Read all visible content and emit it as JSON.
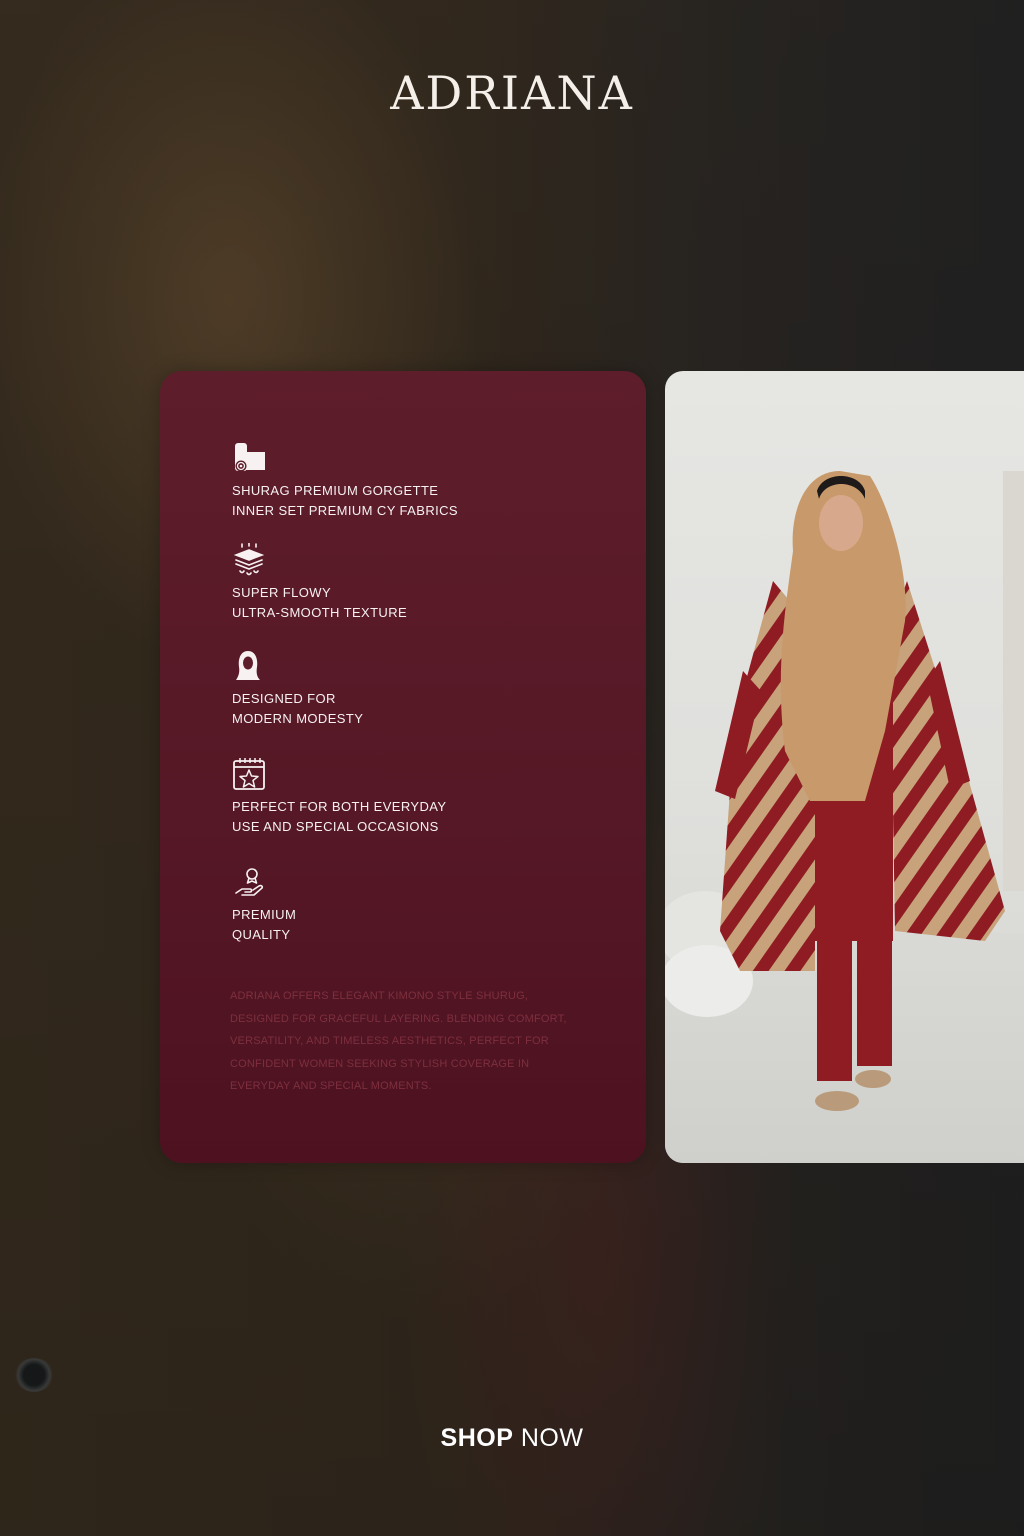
{
  "brand": {
    "name": "ADRIANA"
  },
  "features": [
    {
      "icon": "fabric-roll-icon",
      "line1": "SHURAG PREMIUM GORGETTE",
      "line2": "INNER SET PREMIUM CY FABRICS"
    },
    {
      "icon": "flowy-texture-icon",
      "line1": "SUPER FLOWY",
      "line2": "ULTRA-SMOOTH TEXTURE"
    },
    {
      "icon": "hijab-woman-icon",
      "line1": "DESIGNED FOR",
      "line2": "MODERN MODESTY"
    },
    {
      "icon": "calendar-star-icon",
      "line1": "PERFECT FOR BOTH EVERYDAY",
      "line2": "USE AND SPECIAL OCCASIONS"
    },
    {
      "icon": "hand-award-icon",
      "line1": "PREMIUM",
      "line2": "QUALITY"
    }
  ],
  "description": "ADRIANA OFFERS ELEGANT KIMONO STYLE SHURUG, DESIGNED FOR GRACEFUL LAYERING. BLENDING COMFORT, VERSATILITY, AND TIMELESS AESTHETICS, PERFECT FOR CONFIDENT WOMEN SEEKING STYLISH COVERAGE IN EVERYDAY AND SPECIAL MOMENTS.",
  "cta": {
    "bold": "SHOP",
    "rest": " NOW"
  },
  "colors": {
    "card": "#5a1a28",
    "description_text": "#7e2f3e",
    "garment_maroon": "#8e1c22",
    "scarf_tan": "#c8996a"
  }
}
